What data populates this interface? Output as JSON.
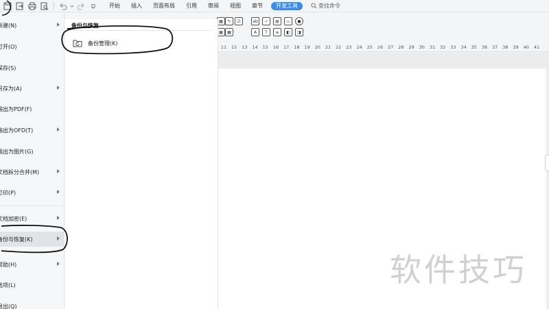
{
  "toolbar": {
    "tabs": [
      {
        "label": "开始"
      },
      {
        "label": "插入"
      },
      {
        "label": "页面布局"
      },
      {
        "label": "引用"
      },
      {
        "label": "审阅"
      },
      {
        "label": "视图"
      },
      {
        "label": "章节"
      },
      {
        "label": "开发工具",
        "active": true
      }
    ],
    "search_label": "查找命令"
  },
  "file_menu": {
    "items": [
      {
        "label": "新建(N)",
        "has_submenu": true
      },
      {
        "label": "打开(O)",
        "has_submenu": false
      },
      {
        "label": "保存(S)",
        "has_submenu": false
      },
      {
        "label": "另存为(A)",
        "has_submenu": true
      },
      {
        "label": "输出为PDF(F)",
        "has_submenu": false
      },
      {
        "label": "输出为OFD(T)",
        "has_submenu": true
      },
      {
        "label": "输出为图片(G)",
        "has_submenu": false
      },
      {
        "label": "文档拆分合并(M)",
        "has_submenu": true
      },
      {
        "label": "打印(P)",
        "has_submenu": true
      },
      {
        "label": "文档加密(E)",
        "has_submenu": true
      },
      {
        "label": "备份与恢复(K)",
        "has_submenu": true,
        "selected": true
      },
      {
        "label": "帮助(H)",
        "has_submenu": true
      },
      {
        "label": "选项(L)",
        "has_submenu": false
      },
      {
        "label": "退出(Q)",
        "has_submenu": false
      }
    ]
  },
  "submenu": {
    "title": "备份与恢复",
    "items": [
      {
        "label": "备份管理(K)",
        "icon": "folder-restore-icon"
      }
    ]
  },
  "ruler": {
    "numbers": [
      "11",
      "12",
      "13",
      "14",
      "15",
      "16",
      "17",
      "18",
      "19",
      "20",
      "21",
      "22",
      "23",
      "24",
      "25",
      "26",
      "27",
      "28",
      "29",
      "30",
      "31",
      "32",
      "33",
      "34",
      "35",
      "36",
      "37",
      "38",
      "39",
      "40",
      "41"
    ]
  },
  "watermark": "软件技巧",
  "colors": {
    "accent": "#3b8cf0",
    "menu_bg": "#f6f7f9",
    "selected_bg": "#e0e3e8",
    "watermark": "#d0d0d0"
  }
}
